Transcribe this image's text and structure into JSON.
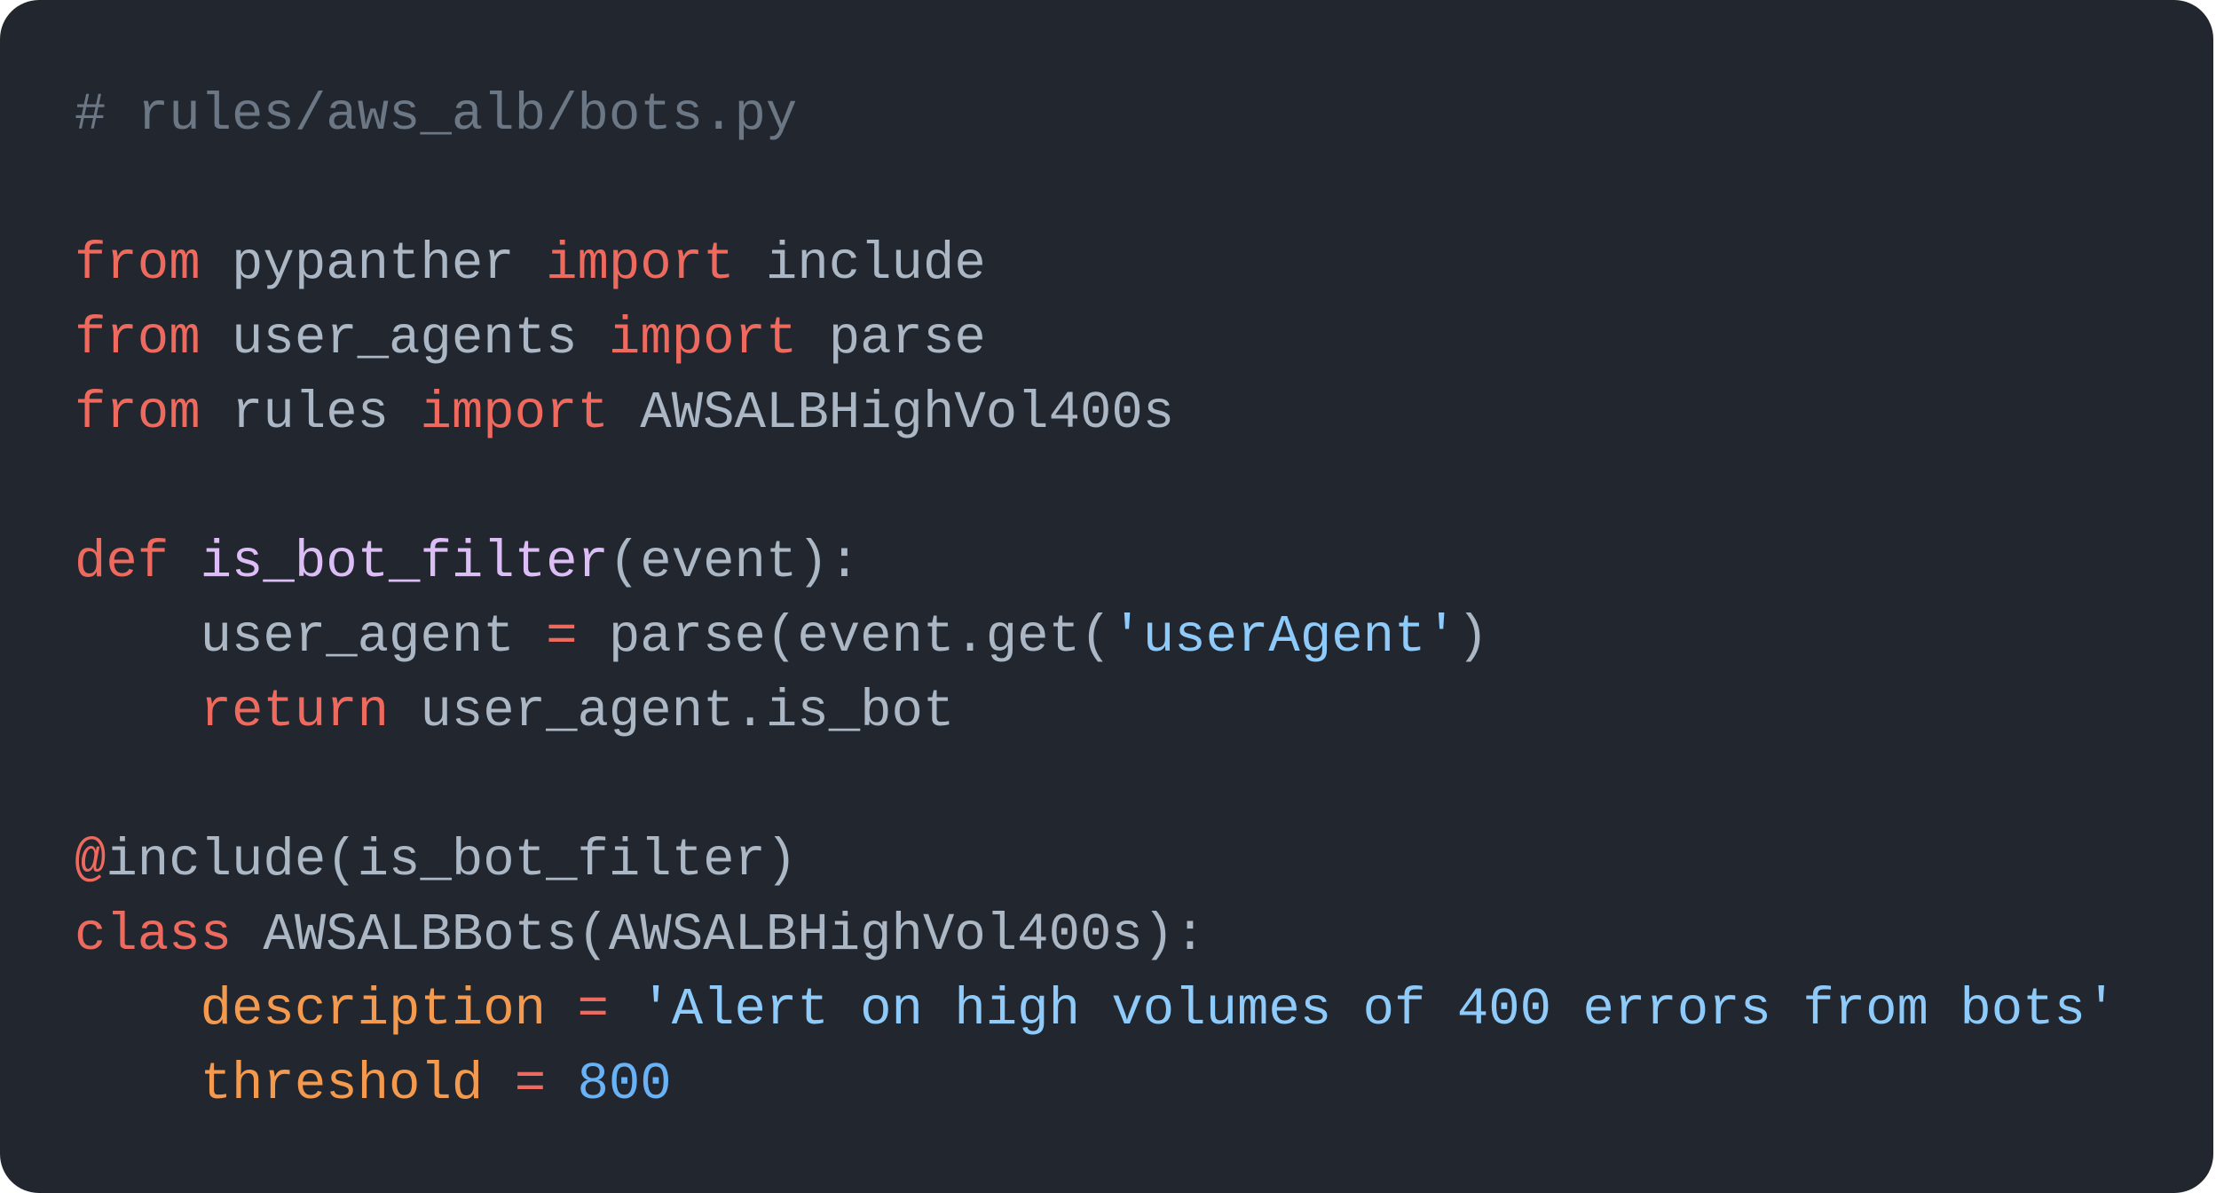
{
  "colors": {
    "background": "#22262e",
    "comment": "#6c7785",
    "keyword": "#ee6a5f",
    "identifier": "#abb7c4",
    "function_name": "#dcbdf5",
    "string": "#8ecbfa",
    "number": "#69b2f6",
    "attribute": "#f49a4e"
  },
  "code": {
    "language": "python",
    "lines": [
      [
        {
          "t": "comment",
          "v": "# rules/aws_alb/bots.py"
        }
      ],
      [],
      [
        {
          "t": "keyword",
          "v": "from"
        },
        {
          "t": "ident",
          "v": " pypanther "
        },
        {
          "t": "keyword",
          "v": "import"
        },
        {
          "t": "ident",
          "v": " include"
        }
      ],
      [
        {
          "t": "keyword",
          "v": "from"
        },
        {
          "t": "ident",
          "v": " user_agents "
        },
        {
          "t": "keyword",
          "v": "import"
        },
        {
          "t": "ident",
          "v": " parse"
        }
      ],
      [
        {
          "t": "keyword",
          "v": "from"
        },
        {
          "t": "ident",
          "v": " rules "
        },
        {
          "t": "keyword",
          "v": "import"
        },
        {
          "t": "ident",
          "v": " AWSALBHighVol400s"
        }
      ],
      [],
      [
        {
          "t": "keyword",
          "v": "def"
        },
        {
          "t": "ident",
          "v": " "
        },
        {
          "t": "func",
          "v": "is_bot_filter"
        },
        {
          "t": "punct",
          "v": "(event):"
        }
      ],
      [
        {
          "t": "ident",
          "v": "    user_agent "
        },
        {
          "t": "op",
          "v": "="
        },
        {
          "t": "ident",
          "v": " parse(event.get("
        },
        {
          "t": "string",
          "v": "'userAgent'"
        },
        {
          "t": "punct",
          "v": ")"
        }
      ],
      [
        {
          "t": "ident",
          "v": "    "
        },
        {
          "t": "keyword",
          "v": "return"
        },
        {
          "t": "ident",
          "v": " user_agent.is_bot"
        }
      ],
      [],
      [
        {
          "t": "deco",
          "v": "@"
        },
        {
          "t": "ident",
          "v": "include(is_bot_filter)"
        }
      ],
      [
        {
          "t": "keyword",
          "v": "class"
        },
        {
          "t": "ident",
          "v": " AWSALBBots(AWSALBHighVol400s):"
        }
      ],
      [
        {
          "t": "ident",
          "v": "    "
        },
        {
          "t": "attr",
          "v": "description"
        },
        {
          "t": "ident",
          "v": " "
        },
        {
          "t": "op",
          "v": "="
        },
        {
          "t": "ident",
          "v": " "
        },
        {
          "t": "string",
          "v": "'Alert on high volumes of 400 errors from bots'"
        }
      ],
      [
        {
          "t": "ident",
          "v": "    "
        },
        {
          "t": "attr",
          "v": "threshold"
        },
        {
          "t": "ident",
          "v": " "
        },
        {
          "t": "op",
          "v": "="
        },
        {
          "t": "ident",
          "v": " "
        },
        {
          "t": "number",
          "v": "800"
        }
      ]
    ]
  }
}
